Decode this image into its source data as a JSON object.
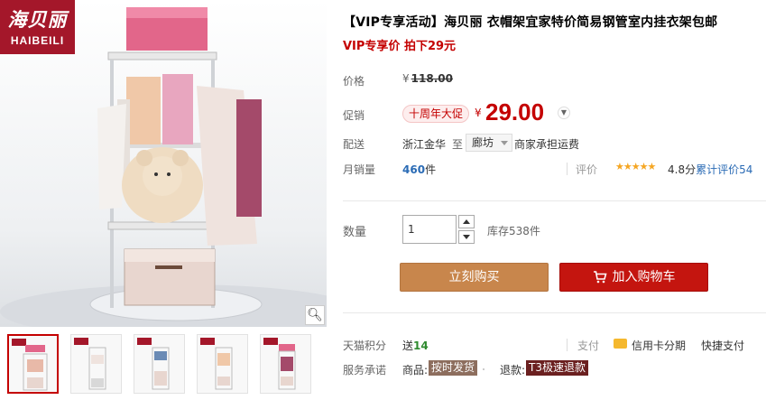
{
  "brand": {
    "cn": "海贝丽",
    "en": "HAIBEILI"
  },
  "product": {
    "title": "【VIP专享活动】海贝丽 衣帽架宜家特价简易钢管室内挂衣架包邮",
    "subtitle": "VIP专享价 拍下29元"
  },
  "price": {
    "label": "价格",
    "currency": "¥",
    "original": "118.00"
  },
  "promo": {
    "label": "促销",
    "tag": "十周年大促",
    "currency": "¥",
    "price": "29.00"
  },
  "shipping": {
    "label": "配送",
    "from": "浙江金华",
    "to_label": "至",
    "to": "廊坊",
    "fee": "商家承担运费"
  },
  "sales": {
    "label": "月销量",
    "count": "460",
    "unit": "件"
  },
  "rating": {
    "label": "评价",
    "stars": "★★★★★",
    "score": "4.8分",
    "count_label": "累计评价",
    "count": "54"
  },
  "quantity": {
    "label": "数量",
    "value": "1",
    "stock": "库存538件"
  },
  "buttons": {
    "buy": "立刻购买",
    "cart": "加入购物车"
  },
  "points": {
    "label": "天猫积分",
    "prefix": "送",
    "value": "14"
  },
  "payment": {
    "label": "支付",
    "card": "信用卡分期",
    "quick": "快捷支付"
  },
  "service": {
    "label": "服务承诺",
    "item1_label": "商品:",
    "item1_tag": "按时发货",
    "item2_label": "退款:",
    "item2_tag": "T3极速退款"
  },
  "icons": {
    "zoom": "magnifier-icon",
    "cart": "cart-icon",
    "card": "credit-card-icon",
    "chevron": "chevron-down-icon"
  },
  "colors": {
    "brand_red": "#a4172a",
    "price_red": "#c40000",
    "buy_button": "#c8864c",
    "cart_button": "#c4150f",
    "link_blue": "#2a6bb5",
    "points_green": "#2f8a2f"
  }
}
